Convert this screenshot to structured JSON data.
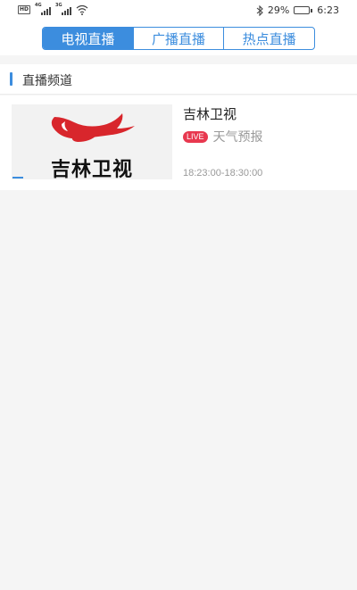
{
  "status_bar": {
    "left_tags": [
      "HD",
      "4G",
      "3G"
    ],
    "battery_percent": "29%",
    "battery_level": 0.29,
    "time": "6:23",
    "icons": [
      "hd-icon",
      "signal-icon",
      "wifi-icon",
      "bluetooth-icon",
      "battery-icon"
    ]
  },
  "tabs": [
    {
      "label": "电视直播",
      "active": true
    },
    {
      "label": "广播直播",
      "active": false
    },
    {
      "label": "热点直播",
      "active": false
    }
  ],
  "section": {
    "title": "直播频道"
  },
  "channels": [
    {
      "logo_text": "吉林卫视",
      "name": "吉林卫视",
      "live_badge": "LIVE",
      "program": "天气预报",
      "time": "18:23:00-18:30:00"
    }
  ],
  "colors": {
    "accent": "#3c8dde",
    "live_badge": "#e8384f",
    "logo_red": "#d8262c",
    "background": "#f5f5f5"
  }
}
